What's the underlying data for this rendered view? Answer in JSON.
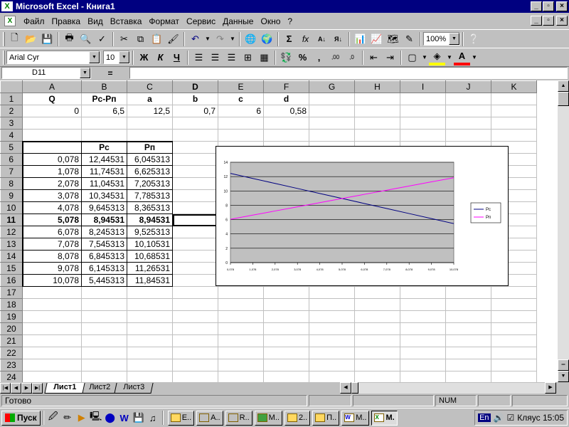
{
  "window": {
    "title": "Microsoft Excel - Книга1",
    "controls": {
      "minimize": "_",
      "maximize": "▫",
      "close": "×"
    }
  },
  "menu": {
    "items": [
      {
        "label": "Файл"
      },
      {
        "label": "Правка"
      },
      {
        "label": "Вид"
      },
      {
        "label": "Вставка"
      },
      {
        "label": "Формат"
      },
      {
        "label": "Сервис"
      },
      {
        "label": "Данные"
      },
      {
        "label": "Окно"
      },
      {
        "label": "?"
      }
    ]
  },
  "toolbar1": {
    "icons": [
      "new-icon",
      "open-icon",
      "save-icon",
      "print-icon",
      "print-preview-icon",
      "spelling-icon",
      "cut-icon",
      "copy-icon",
      "paste-icon",
      "format-painter-icon",
      "undo-icon",
      "redo-icon",
      "hyperlink-icon",
      "web-toolbar-icon",
      "autosum-icon",
      "function-icon",
      "sort-asc-icon",
      "sort-desc-icon",
      "chart-wizard-icon",
      "map-icon",
      "drawing-icon"
    ],
    "zoom": "100%"
  },
  "toolbar2": {
    "font": "Arial Cyr",
    "size": "10",
    "bold": "Ж",
    "italic": "К",
    "underline": "Ч",
    "percent": "%",
    "comma": ","
  },
  "formula_bar": {
    "name_box": "D11",
    "equals": "=",
    "content": ""
  },
  "columns": [
    "A",
    "B",
    "C",
    "D",
    "E",
    "F",
    "G",
    "H",
    "I",
    "J",
    "K"
  ],
  "rows": [
    {
      "n": "1",
      "cells": [
        "Q",
        "Pc-Pп",
        "a",
        "b",
        "c",
        "d",
        "",
        "",
        "",
        "",
        ""
      ]
    },
    {
      "n": "2",
      "cells": [
        "0",
        "6,5",
        "12,5",
        "0,7",
        "6",
        "0,58",
        "",
        "",
        "",
        "",
        ""
      ]
    },
    {
      "n": "3",
      "cells": [
        "",
        "",
        "",
        "",
        "",
        "",
        "",
        "",
        "",
        "",
        ""
      ]
    },
    {
      "n": "4",
      "cells": [
        "",
        "",
        "",
        "",
        "",
        "",
        "",
        "",
        "",
        "",
        ""
      ]
    },
    {
      "n": "5",
      "cells": [
        "",
        "Pc",
        "Pп",
        "",
        "",
        "",
        "",
        "",
        "",
        "",
        ""
      ]
    },
    {
      "n": "6",
      "cells": [
        "0,078",
        "12,44531",
        "6,045313",
        "",
        "",
        "",
        "",
        "",
        "",
        "",
        ""
      ]
    },
    {
      "n": "7",
      "cells": [
        "1,078",
        "11,74531",
        "6,625313",
        "",
        "",
        "",
        "",
        "",
        "",
        "",
        ""
      ]
    },
    {
      "n": "8",
      "cells": [
        "2,078",
        "11,04531",
        "7,205313",
        "",
        "",
        "",
        "",
        "",
        "",
        "",
        ""
      ]
    },
    {
      "n": "9",
      "cells": [
        "3,078",
        "10,34531",
        "7,785313",
        "",
        "",
        "",
        "",
        "",
        "",
        "",
        ""
      ]
    },
    {
      "n": "10",
      "cells": [
        "4,078",
        "9,645313",
        "8,365313",
        "",
        "",
        "",
        "",
        "",
        "",
        "",
        ""
      ]
    },
    {
      "n": "11",
      "cells": [
        "5,078",
        "8,94531",
        "8,94531",
        "",
        "",
        "",
        "",
        "",
        "",
        "",
        ""
      ]
    },
    {
      "n": "12",
      "cells": [
        "6,078",
        "8,245313",
        "9,525313",
        "",
        "",
        "",
        "",
        "",
        "",
        "",
        ""
      ]
    },
    {
      "n": "13",
      "cells": [
        "7,078",
        "7,545313",
        "10,10531",
        "",
        "",
        "",
        "",
        "",
        "",
        "",
        ""
      ]
    },
    {
      "n": "14",
      "cells": [
        "8,078",
        "6,845313",
        "10,68531",
        "",
        "",
        "",
        "",
        "",
        "",
        "",
        ""
      ]
    },
    {
      "n": "15",
      "cells": [
        "9,078",
        "6,145313",
        "11,26531",
        "",
        "",
        "",
        "",
        "",
        "",
        "",
        ""
      ]
    },
    {
      "n": "16",
      "cells": [
        "10,078",
        "5,445313",
        "11,84531",
        "",
        "",
        "",
        "",
        "",
        "",
        "",
        ""
      ]
    },
    {
      "n": "17",
      "cells": [
        "",
        "",
        "",
        "",
        "",
        "",
        "",
        "",
        "",
        "",
        ""
      ]
    },
    {
      "n": "18",
      "cells": [
        "",
        "",
        "",
        "",
        "",
        "",
        "",
        "",
        "",
        "",
        ""
      ]
    },
    {
      "n": "19",
      "cells": [
        "",
        "",
        "",
        "",
        "",
        "",
        "",
        "",
        "",
        "",
        ""
      ]
    },
    {
      "n": "20",
      "cells": [
        "",
        "",
        "",
        "",
        "",
        "",
        "",
        "",
        "",
        "",
        ""
      ]
    },
    {
      "n": "21",
      "cells": [
        "",
        "",
        "",
        "",
        "",
        "",
        "",
        "",
        "",
        "",
        ""
      ]
    },
    {
      "n": "22",
      "cells": [
        "",
        "",
        "",
        "",
        "",
        "",
        "",
        "",
        "",
        "",
        ""
      ]
    },
    {
      "n": "23",
      "cells": [
        "",
        "",
        "",
        "",
        "",
        "",
        "",
        "",
        "",
        "",
        ""
      ]
    },
    {
      "n": "24",
      "cells": [
        "",
        "",
        "",
        "",
        "",
        "",
        "",
        "",
        "",
        "",
        ""
      ]
    }
  ],
  "chart_data": {
    "type": "line",
    "x": [
      "0,078",
      "1,078",
      "2,078",
      "3,078",
      "4,078",
      "5,078",
      "6,078",
      "7,078",
      "8,078",
      "9,078",
      "10,078"
    ],
    "series": [
      {
        "name": "Pc",
        "color": "#000080",
        "values": [
          12.44531,
          11.74531,
          11.04531,
          10.34531,
          9.645313,
          8.94531,
          8.245313,
          7.545313,
          6.845313,
          6.145313,
          5.445313
        ]
      },
      {
        "name": "Pп",
        "color": "#ff00ff",
        "values": [
          6.045313,
          6.625313,
          7.205313,
          7.785313,
          8.365313,
          8.94531,
          9.525313,
          10.10531,
          10.68531,
          11.26531,
          11.84531
        ]
      }
    ],
    "yticks": [
      "0",
      "2",
      "4",
      "6",
      "8",
      "10",
      "12",
      "14"
    ],
    "ylim": [
      0,
      14
    ],
    "grid": true,
    "legend": "right",
    "plot_bg": "#c0c0c0"
  },
  "sheets": {
    "tabs": [
      "Лист1",
      "Лист2",
      "Лист3"
    ],
    "active": "Лист1"
  },
  "status": {
    "text": "Готово",
    "num": "NUM"
  },
  "taskbar": {
    "start": "Пуск",
    "tasks": [
      {
        "label": "E.."
      },
      {
        "label": "A.."
      },
      {
        "label": "R.."
      },
      {
        "label": "M.."
      },
      {
        "label": "2.."
      },
      {
        "label": "П.."
      },
      {
        "label": "M.."
      },
      {
        "label": "M.",
        "active": true
      }
    ],
    "tray": {
      "lang": "En",
      "clock": "Кляус 15:05"
    }
  }
}
